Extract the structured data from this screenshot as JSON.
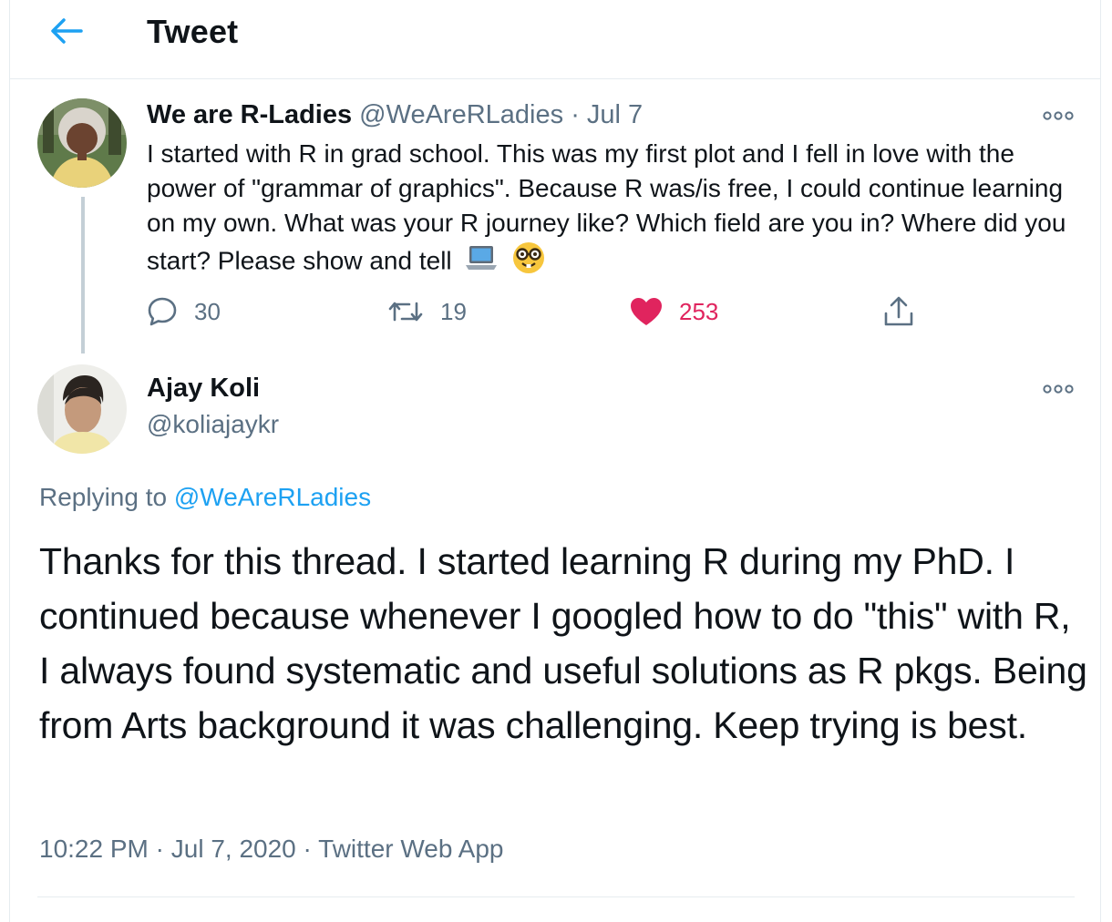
{
  "header": {
    "title": "Tweet"
  },
  "parent_tweet": {
    "name": "We are R-Ladies",
    "handle": "@WeAreRLadies",
    "separator": "·",
    "date": "Jul 7",
    "text": "I started with R in grad school. This was my first plot and I fell in love with the power of \"grammar of graphics\". Because R was/is free, I could continue learning on my own. What was your R journey like? Which field are you in? Where did you start? Please show and tell",
    "emojis": [
      "laptop-emoji",
      "nerd-face-emoji"
    ],
    "replies": "30",
    "retweets": "19",
    "likes": "253",
    "like_color": "#e0245e"
  },
  "reply_tweet": {
    "name": "Ajay Koli",
    "handle": "@koliajaykr",
    "replying_prefix": "Replying to",
    "replying_to": "@WeAreRLadies",
    "text": "Thanks for this thread. I started learning R during my PhD. I continued because whenever I googled how to do \"this\" with R, I always found systematic and useful solutions as R pkgs. Being from Arts background it was challenging. Keep trying is best.",
    "time": "10:22 PM",
    "sep1": "·",
    "date": "Jul 7, 2020",
    "sep2": "·",
    "app": "Twitter Web App"
  },
  "colors": {
    "accent": "#1da1f2",
    "muted": "#5b7083",
    "like": "#e0245e"
  },
  "icons": {
    "back": "arrow-left-icon",
    "more": "more-horizontal-icon",
    "reply": "reply-bubble-icon",
    "retweet": "retweet-icon",
    "like": "heart-icon",
    "share": "share-icon"
  }
}
